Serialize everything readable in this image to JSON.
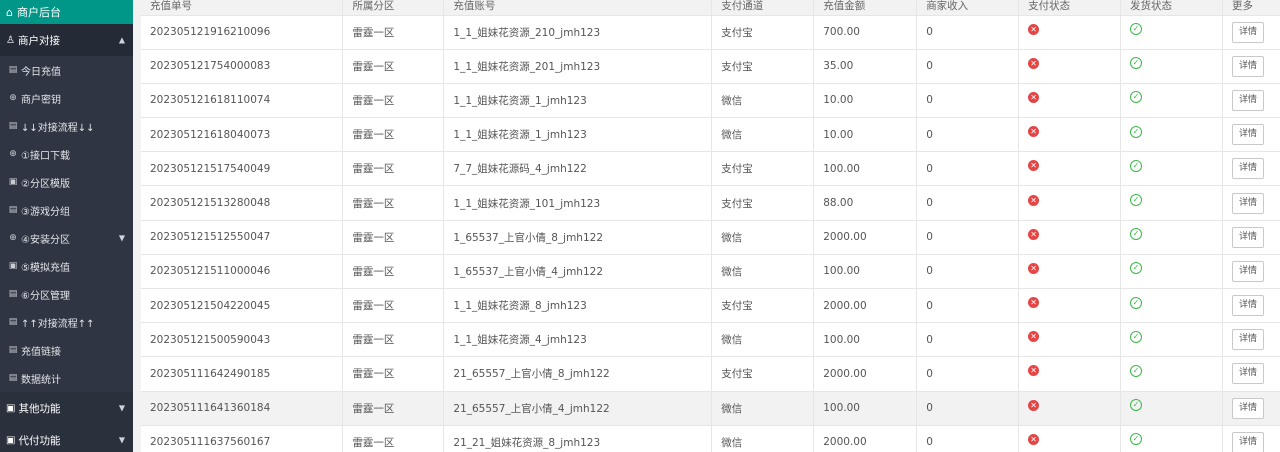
{
  "sidebar": {
    "brand": "商户后台",
    "groups": [
      {
        "label": "商户对接",
        "open": true
      },
      {
        "label": "其他功能"
      },
      {
        "label": "代付功能"
      }
    ],
    "items": [
      {
        "label": "今日充值",
        "icon": "document-icon"
      },
      {
        "label": "商户密钥",
        "icon": "plus-circle-icon"
      },
      {
        "label": "↓↓对接流程↓↓",
        "icon": "document-icon"
      },
      {
        "label": "①接口下载",
        "icon": "plus-circle-icon"
      },
      {
        "label": "②分区模版",
        "icon": "template-icon"
      },
      {
        "label": "③游戏分组",
        "icon": "document-icon"
      },
      {
        "label": "④安装分区",
        "icon": "plus-circle-icon"
      },
      {
        "label": "⑤模拟充值",
        "icon": "template-icon"
      },
      {
        "label": "⑥分区管理",
        "icon": "document-icon"
      },
      {
        "label": "↑↑对接流程↑↑",
        "icon": "document-icon"
      },
      {
        "label": "充值链接",
        "icon": "document-icon"
      },
      {
        "label": "数据统计",
        "icon": "document-icon"
      }
    ]
  },
  "table": {
    "headers": [
      "充值单号",
      "所属分区",
      "充值账号",
      "支付通道",
      "充值金额",
      "商家收入",
      "支付状态",
      "发货状态",
      "更多"
    ],
    "detail_label": "详情",
    "rows": [
      {
        "order": "202305121916210096",
        "zone": "雷霆一区",
        "account": "1_1_姐妹花资源_210_jmh123",
        "channel": "支付宝",
        "amount": "700.00",
        "income": "0"
      },
      {
        "order": "202305121754000083",
        "zone": "雷霆一区",
        "account": "1_1_姐妹花资源_201_jmh123",
        "channel": "支付宝",
        "amount": "35.00",
        "income": "0"
      },
      {
        "order": "202305121618110074",
        "zone": "雷霆一区",
        "account": "1_1_姐妹花资源_1_jmh123",
        "channel": "微信",
        "amount": "10.00",
        "income": "0"
      },
      {
        "order": "202305121618040073",
        "zone": "雷霆一区",
        "account": "1_1_姐妹花资源_1_jmh123",
        "channel": "微信",
        "amount": "10.00",
        "income": "0"
      },
      {
        "order": "202305121517540049",
        "zone": "雷霆一区",
        "account": "7_7_姐妹花源码_4_jmh122",
        "channel": "支付宝",
        "amount": "100.00",
        "income": "0"
      },
      {
        "order": "202305121513280048",
        "zone": "雷霆一区",
        "account": "1_1_姐妹花资源_101_jmh123",
        "channel": "支付宝",
        "amount": "88.00",
        "income": "0"
      },
      {
        "order": "202305121512550047",
        "zone": "雷霆一区",
        "account": "1_65537_上官小倩_8_jmh122",
        "channel": "微信",
        "amount": "2000.00",
        "income": "0"
      },
      {
        "order": "202305121511000046",
        "zone": "雷霆一区",
        "account": "1_65537_上官小倩_4_jmh122",
        "channel": "微信",
        "amount": "100.00",
        "income": "0"
      },
      {
        "order": "202305121504220045",
        "zone": "雷霆一区",
        "account": "1_1_姐妹花资源_8_jmh123",
        "channel": "支付宝",
        "amount": "2000.00",
        "income": "0"
      },
      {
        "order": "202305121500590043",
        "zone": "雷霆一区",
        "account": "1_1_姐妹花资源_4_jmh123",
        "channel": "微信",
        "amount": "100.00",
        "income": "0"
      },
      {
        "order": "202305111642490185",
        "zone": "雷霆一区",
        "account": "21_65557_上官小倩_8_jmh122",
        "channel": "支付宝",
        "amount": "2000.00",
        "income": "0"
      },
      {
        "order": "202305111641360184",
        "zone": "雷霆一区",
        "account": "21_65557_上官小倩_4_jmh122",
        "channel": "微信",
        "amount": "100.00",
        "income": "0",
        "highlight": true
      },
      {
        "order": "202305111637560167",
        "zone": "雷霆一区",
        "account": "21_21_姐妹花资源_8_jmh123",
        "channel": "微信",
        "amount": "2000.00",
        "income": "0"
      }
    ]
  }
}
